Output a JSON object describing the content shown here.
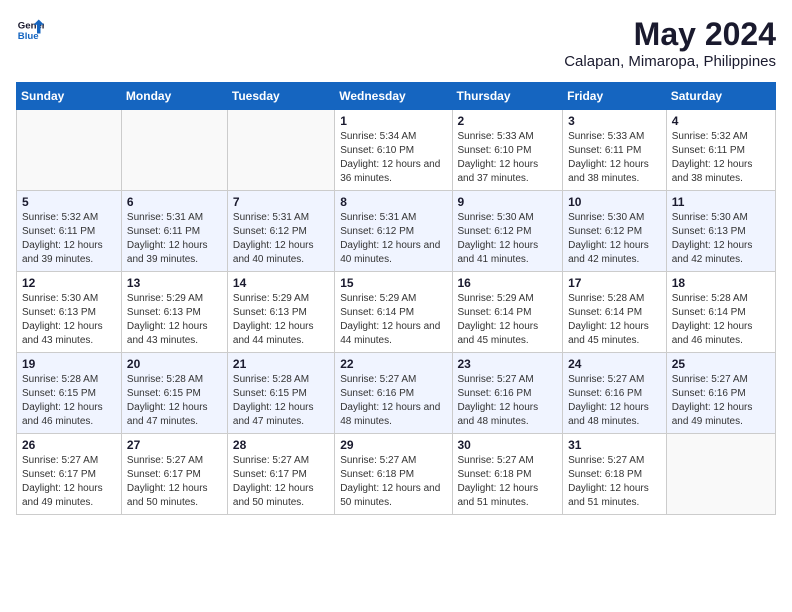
{
  "header": {
    "logo_general": "General",
    "logo_blue": "Blue",
    "title": "May 2024",
    "subtitle": "Calapan, Mimaropa, Philippines"
  },
  "calendar": {
    "weekdays": [
      "Sunday",
      "Monday",
      "Tuesday",
      "Wednesday",
      "Thursday",
      "Friday",
      "Saturday"
    ],
    "weeks": [
      [
        {
          "day": "",
          "info": ""
        },
        {
          "day": "",
          "info": ""
        },
        {
          "day": "",
          "info": ""
        },
        {
          "day": "1",
          "info": "Sunrise: 5:34 AM\nSunset: 6:10 PM\nDaylight: 12 hours and 36 minutes."
        },
        {
          "day": "2",
          "info": "Sunrise: 5:33 AM\nSunset: 6:10 PM\nDaylight: 12 hours and 37 minutes."
        },
        {
          "day": "3",
          "info": "Sunrise: 5:33 AM\nSunset: 6:11 PM\nDaylight: 12 hours and 38 minutes."
        },
        {
          "day": "4",
          "info": "Sunrise: 5:32 AM\nSunset: 6:11 PM\nDaylight: 12 hours and 38 minutes."
        }
      ],
      [
        {
          "day": "5",
          "info": "Sunrise: 5:32 AM\nSunset: 6:11 PM\nDaylight: 12 hours and 39 minutes."
        },
        {
          "day": "6",
          "info": "Sunrise: 5:31 AM\nSunset: 6:11 PM\nDaylight: 12 hours and 39 minutes."
        },
        {
          "day": "7",
          "info": "Sunrise: 5:31 AM\nSunset: 6:12 PM\nDaylight: 12 hours and 40 minutes."
        },
        {
          "day": "8",
          "info": "Sunrise: 5:31 AM\nSunset: 6:12 PM\nDaylight: 12 hours and 40 minutes."
        },
        {
          "day": "9",
          "info": "Sunrise: 5:30 AM\nSunset: 6:12 PM\nDaylight: 12 hours and 41 minutes."
        },
        {
          "day": "10",
          "info": "Sunrise: 5:30 AM\nSunset: 6:12 PM\nDaylight: 12 hours and 42 minutes."
        },
        {
          "day": "11",
          "info": "Sunrise: 5:30 AM\nSunset: 6:13 PM\nDaylight: 12 hours and 42 minutes."
        }
      ],
      [
        {
          "day": "12",
          "info": "Sunrise: 5:30 AM\nSunset: 6:13 PM\nDaylight: 12 hours and 43 minutes."
        },
        {
          "day": "13",
          "info": "Sunrise: 5:29 AM\nSunset: 6:13 PM\nDaylight: 12 hours and 43 minutes."
        },
        {
          "day": "14",
          "info": "Sunrise: 5:29 AM\nSunset: 6:13 PM\nDaylight: 12 hours and 44 minutes."
        },
        {
          "day": "15",
          "info": "Sunrise: 5:29 AM\nSunset: 6:14 PM\nDaylight: 12 hours and 44 minutes."
        },
        {
          "day": "16",
          "info": "Sunrise: 5:29 AM\nSunset: 6:14 PM\nDaylight: 12 hours and 45 minutes."
        },
        {
          "day": "17",
          "info": "Sunrise: 5:28 AM\nSunset: 6:14 PM\nDaylight: 12 hours and 45 minutes."
        },
        {
          "day": "18",
          "info": "Sunrise: 5:28 AM\nSunset: 6:14 PM\nDaylight: 12 hours and 46 minutes."
        }
      ],
      [
        {
          "day": "19",
          "info": "Sunrise: 5:28 AM\nSunset: 6:15 PM\nDaylight: 12 hours and 46 minutes."
        },
        {
          "day": "20",
          "info": "Sunrise: 5:28 AM\nSunset: 6:15 PM\nDaylight: 12 hours and 47 minutes."
        },
        {
          "day": "21",
          "info": "Sunrise: 5:28 AM\nSunset: 6:15 PM\nDaylight: 12 hours and 47 minutes."
        },
        {
          "day": "22",
          "info": "Sunrise: 5:27 AM\nSunset: 6:16 PM\nDaylight: 12 hours and 48 minutes."
        },
        {
          "day": "23",
          "info": "Sunrise: 5:27 AM\nSunset: 6:16 PM\nDaylight: 12 hours and 48 minutes."
        },
        {
          "day": "24",
          "info": "Sunrise: 5:27 AM\nSunset: 6:16 PM\nDaylight: 12 hours and 48 minutes."
        },
        {
          "day": "25",
          "info": "Sunrise: 5:27 AM\nSunset: 6:16 PM\nDaylight: 12 hours and 49 minutes."
        }
      ],
      [
        {
          "day": "26",
          "info": "Sunrise: 5:27 AM\nSunset: 6:17 PM\nDaylight: 12 hours and 49 minutes."
        },
        {
          "day": "27",
          "info": "Sunrise: 5:27 AM\nSunset: 6:17 PM\nDaylight: 12 hours and 50 minutes."
        },
        {
          "day": "28",
          "info": "Sunrise: 5:27 AM\nSunset: 6:17 PM\nDaylight: 12 hours and 50 minutes."
        },
        {
          "day": "29",
          "info": "Sunrise: 5:27 AM\nSunset: 6:18 PM\nDaylight: 12 hours and 50 minutes."
        },
        {
          "day": "30",
          "info": "Sunrise: 5:27 AM\nSunset: 6:18 PM\nDaylight: 12 hours and 51 minutes."
        },
        {
          "day": "31",
          "info": "Sunrise: 5:27 AM\nSunset: 6:18 PM\nDaylight: 12 hours and 51 minutes."
        },
        {
          "day": "",
          "info": ""
        }
      ]
    ]
  }
}
